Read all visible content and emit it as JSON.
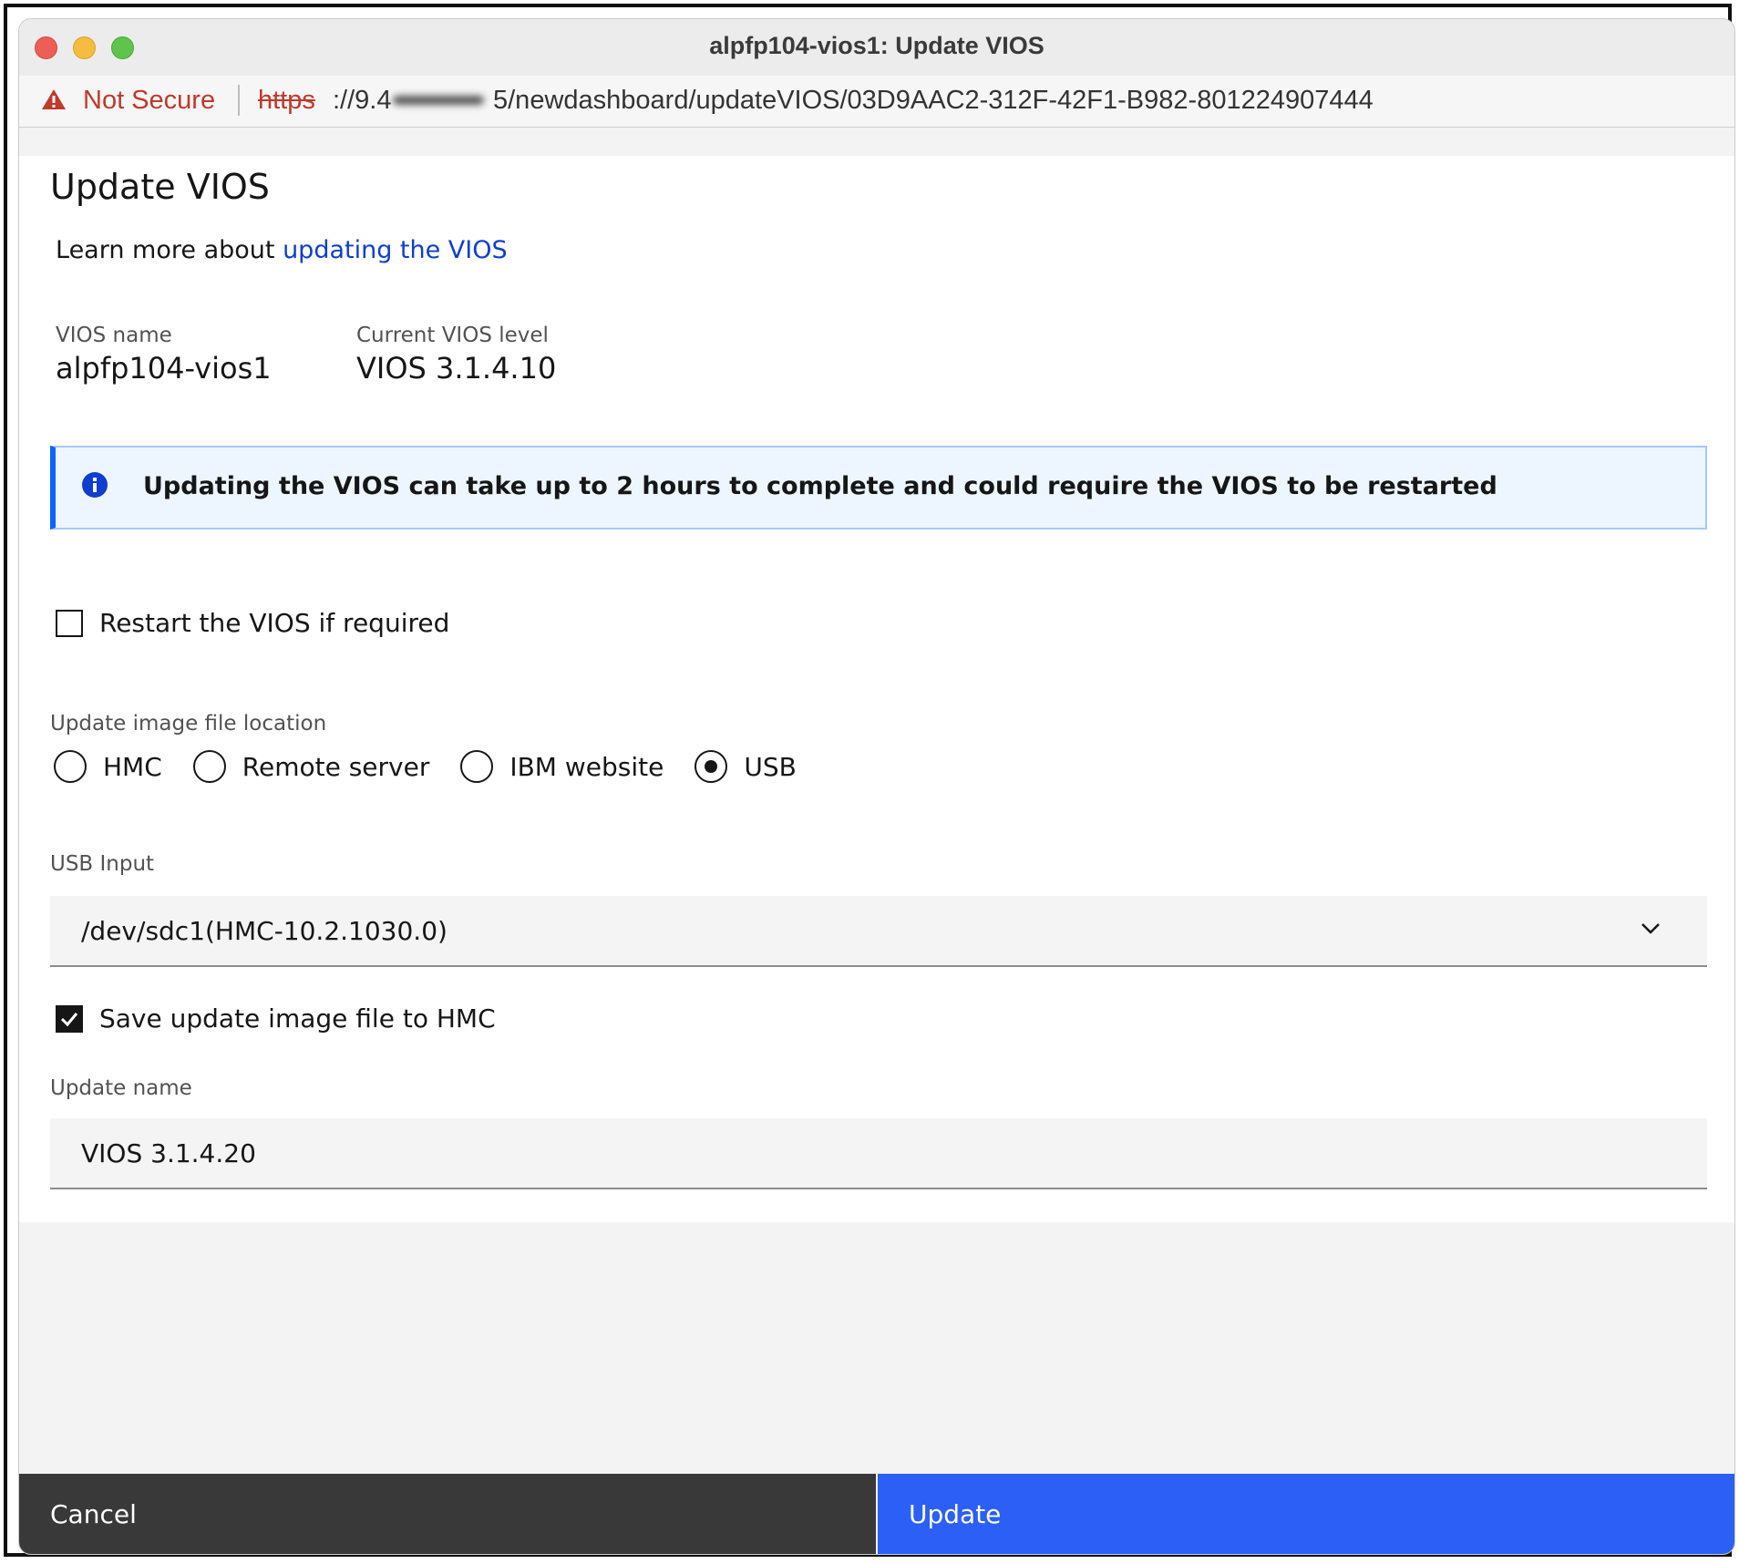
{
  "window": {
    "title": "alpfp104-vios1: Update VIOS"
  },
  "address_bar": {
    "security_label": "Not Secure",
    "url_scheme": "https",
    "url_host_visible": "://9.4",
    "url_path": "5/newdashboard/updateVIOS/03D9AAC2-312F-42F1-B982-801224907444"
  },
  "dialog": {
    "title": "Update VIOS",
    "learn_more_prefix": "Learn more about ",
    "learn_more_link": "updating the VIOS",
    "vios_name_label": "VIOS name",
    "vios_name_value": "alpfp104-vios1",
    "current_level_label": "Current VIOS level",
    "current_level_value": "VIOS 3.1.4.10",
    "notice": "Updating the VIOS can take up to 2 hours to complete and could require the VIOS to be restarted",
    "restart_checkbox_label": "Restart the VIOS if required",
    "restart_checked": false,
    "location_label": "Update image file location",
    "location_options": [
      "HMC",
      "Remote server",
      "IBM website",
      "USB"
    ],
    "location_selected": "USB",
    "usb_input_label": "USB Input",
    "usb_input_value": "/dev/sdc1(HMC-10.2.1030.0)",
    "save_checkbox_label": "Save update image file to HMC",
    "save_checked": true,
    "update_name_label": "Update name",
    "update_name_value": "VIOS 3.1.4.20"
  },
  "footer": {
    "cancel_label": "Cancel",
    "update_label": "Update"
  },
  "colors": {
    "primary": "#2b5ff5",
    "secondary": "#393939",
    "link": "#0f3ecf",
    "info_border": "#0f62fe",
    "insecure": "#c0392b"
  }
}
